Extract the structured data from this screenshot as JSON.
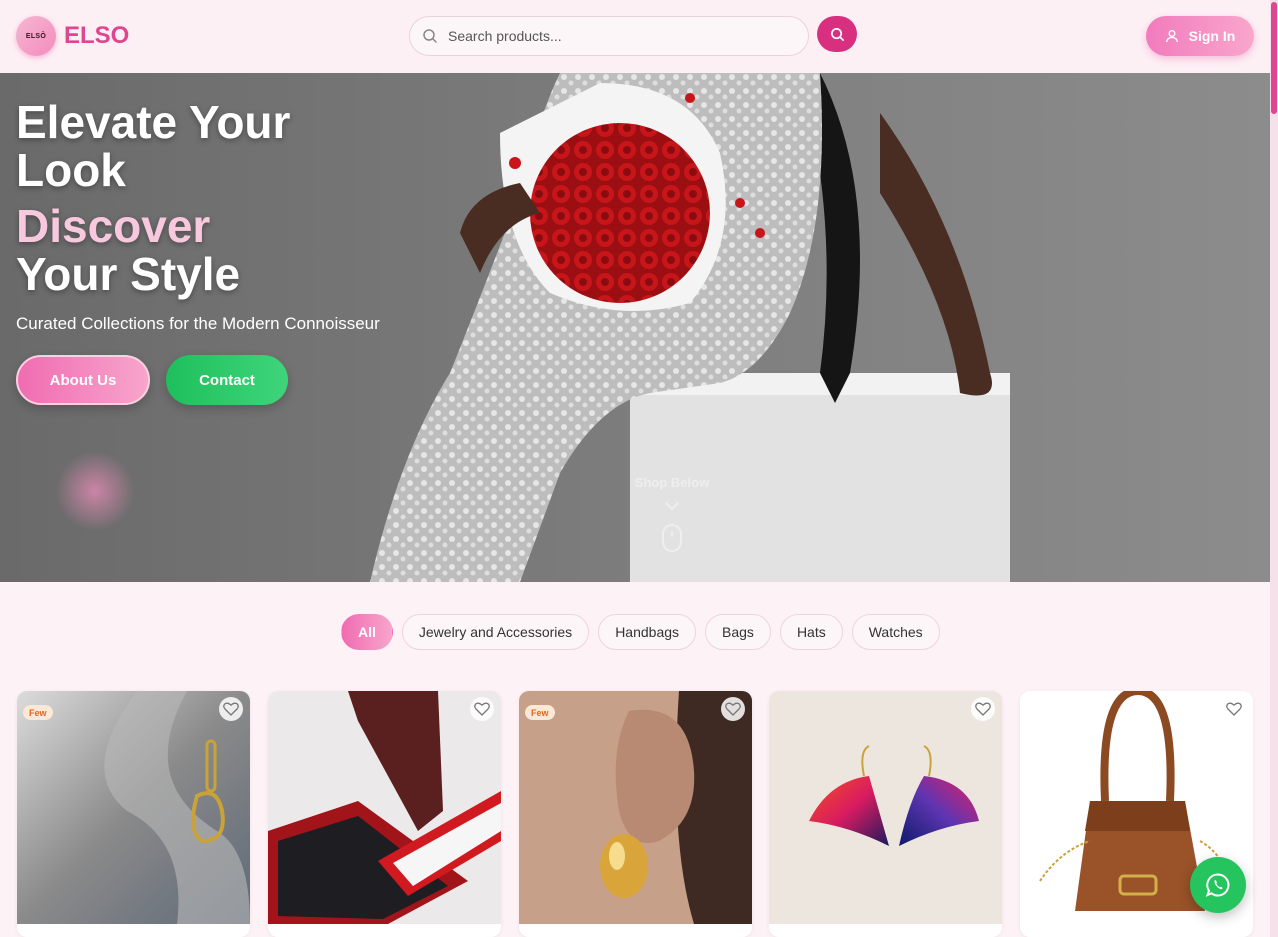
{
  "brand": {
    "logo_text": "ELSO",
    "logo_mark": "ELSŌ"
  },
  "search": {
    "placeholder": "Search products..."
  },
  "auth": {
    "signin_label": "Sign In"
  },
  "hero": {
    "line1": "Elevate Your",
    "line2": "Look",
    "line3": "Discover",
    "line4": "Your Style",
    "subtitle": "Curated Collections for the Modern Connoisseur",
    "about_label": "About Us",
    "contact_label": "Contact",
    "shop_below": "Shop Below"
  },
  "filters": [
    "All",
    "Jewelry and Accessories",
    "Handbags",
    "Bags",
    "Hats",
    "Watches"
  ],
  "products": [
    {
      "badge": "Few"
    },
    {
      "badge": ""
    },
    {
      "badge": "Few"
    },
    {
      "badge": ""
    },
    {
      "badge": ""
    }
  ],
  "colors": {
    "brand_pink": "#e0468f",
    "accent_dark_pink": "#d92f80",
    "whatsapp_green": "#25c45e",
    "contact_green": "#1fbf5c"
  },
  "icons": [
    "search-icon",
    "user-icon",
    "chevron-down-icon",
    "mouse-icon",
    "heart-icon",
    "whatsapp-icon"
  ]
}
